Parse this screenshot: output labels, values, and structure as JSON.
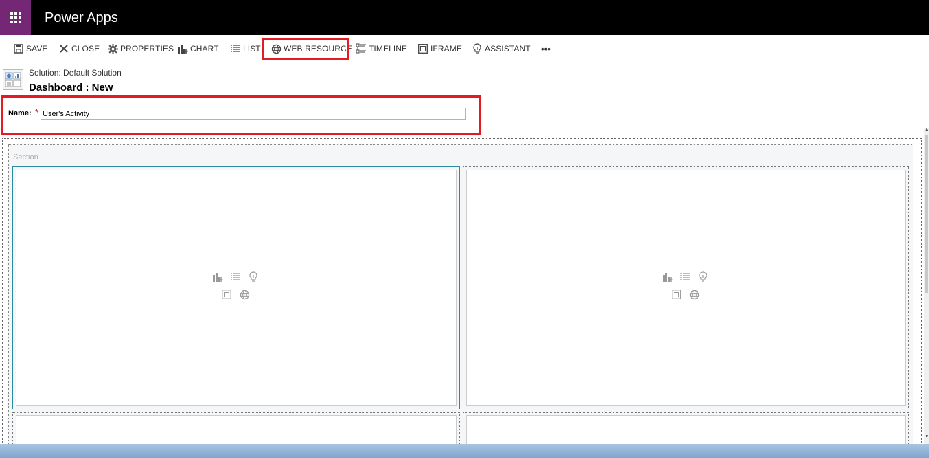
{
  "app": {
    "title": "Power Apps"
  },
  "toolbar": {
    "save_label": "SAVE",
    "close_label": "CLOSE",
    "properties_label": "PROPERTIES",
    "chart_label": "CHART",
    "list_label": "LIST",
    "web_resource_label": "WEB RESOURCE",
    "timeline_label": "TIMELINE",
    "iframe_label": "IFRAME",
    "assistant_label": "ASSISTANT",
    "more_label": "•••"
  },
  "header": {
    "solution": "Solution: Default Solution",
    "title": "Dashboard : New"
  },
  "form": {
    "name_label": "Name:",
    "required_marker": "*",
    "name_value": "User's Activity"
  },
  "layout": {
    "section_label": "Section",
    "placeholder_icons": [
      "chart-icon",
      "list-icon",
      "assistant-icon",
      "iframe-icon",
      "web-resource-icon"
    ]
  },
  "colors": {
    "app_accent": "#742774",
    "highlight": "#e31b23",
    "selected_cell": "#2a8c9e"
  }
}
